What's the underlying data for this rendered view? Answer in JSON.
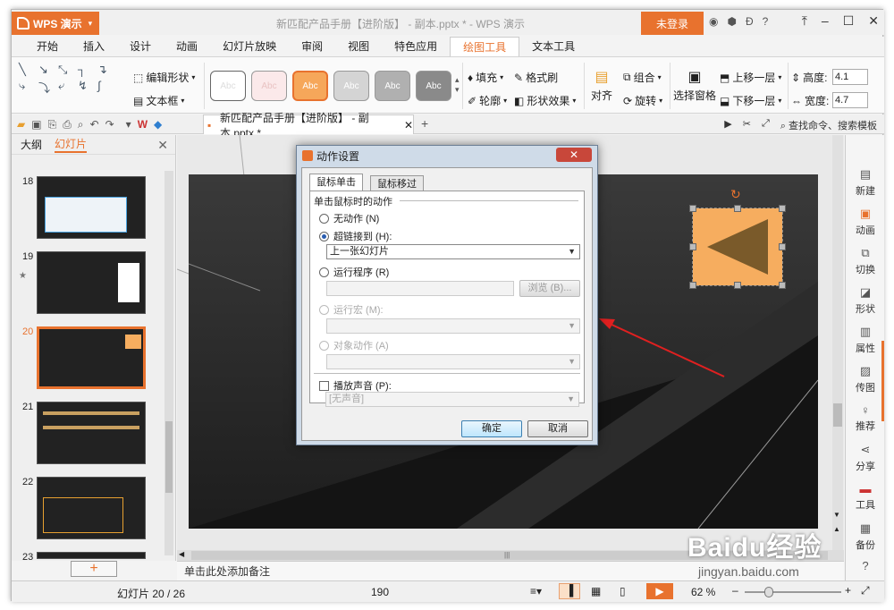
{
  "app": {
    "name": "WPS 演示",
    "doc_title": "新匹配产品手册【进阶版】 - 副本.pptx * - WPS 演示",
    "login": "未登录"
  },
  "menu": [
    "开始",
    "插入",
    "设计",
    "动画",
    "幻灯片放映",
    "审阅",
    "视图",
    "特色应用",
    "绘图工具",
    "文本工具"
  ],
  "ribbon": {
    "edit_shape": "编辑形状",
    "text_box": "文本框",
    "style_label": "Abc",
    "fill": "填充",
    "format_painter": "格式刷",
    "outline": "轮廓",
    "shape_effect": "形状效果",
    "align": "对齐",
    "group": "组合",
    "rotate": "旋转",
    "select_pane": "选择窗格",
    "bring_forward": "上移一层",
    "send_backward": "下移一层",
    "height_label": "高度:",
    "height_value": "4.1",
    "width_label": "宽度:",
    "width_value": "4.7"
  },
  "quickbar": {
    "doc_tab": "新匹配产品手册【进阶版】 - 副本.pptx *",
    "search": "查找命令、搜索模板"
  },
  "left_panel": {
    "tab_outline": "大纲",
    "tab_slides": "幻灯片",
    "slides": [
      {
        "num": "18"
      },
      {
        "num": "19"
      },
      {
        "num": "20",
        "selected": true
      },
      {
        "num": "21"
      },
      {
        "num": "22"
      },
      {
        "num": "23"
      }
    ]
  },
  "notes_placeholder": "单击此处添加备注",
  "right_sidebar": [
    "新建",
    "动画",
    "切换",
    "形状",
    "属性",
    "传图",
    "推荐",
    "分享",
    "工具",
    "备份"
  ],
  "status": {
    "slide_counter": "幻灯片 20 / 26",
    "center_value": "190",
    "zoom": "62 %"
  },
  "dialog": {
    "title": "动作设置",
    "tab_click": "鼠标单击",
    "tab_hover": "鼠标移过",
    "group_title": "单击鼠标时的动作",
    "opt_none": "无动作 (N)",
    "opt_hyperlink": "超链接到 (H):",
    "hyperlink_value": "上一张幻灯片",
    "opt_run_program": "运行程序 (R)",
    "browse": "浏览 (B)...",
    "opt_run_macro": "运行宏 (M):",
    "opt_object_action": "对象动作 (A)",
    "play_sound": "播放声音 (P):",
    "sound_value": "[无声音]",
    "ok": "确定",
    "cancel": "取消"
  },
  "watermark": {
    "brand": "Baidu经验",
    "url": "jingyan.baidu.com"
  },
  "colors": {
    "accent": "#e8722e",
    "shape_fill": "#f6ad5f",
    "triangle": "#7a5a2a"
  }
}
